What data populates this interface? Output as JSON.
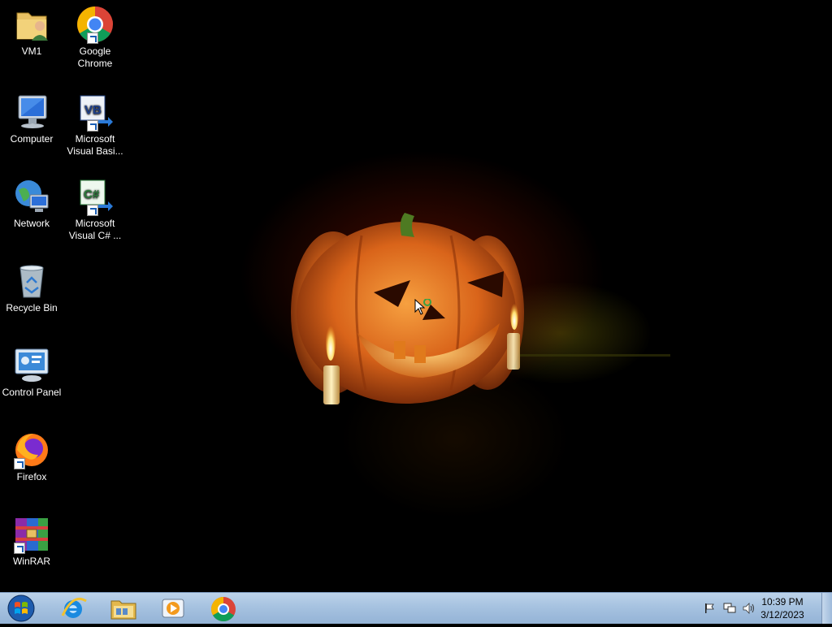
{
  "desktop": {
    "icons": [
      {
        "label": "VM1",
        "icon": "user-folder-icon"
      },
      {
        "label": "Google Chrome",
        "icon": "chrome-icon"
      },
      {
        "label": "Computer",
        "icon": "computer-icon"
      },
      {
        "label": "Microsoft Visual Basi...",
        "icon": "visual-basic-icon"
      },
      {
        "label": "Network",
        "icon": "network-icon"
      },
      {
        "label": "Microsoft Visual C# ...",
        "icon": "visual-csharp-icon"
      },
      {
        "label": "Recycle Bin",
        "icon": "recycle-bin-icon"
      },
      {
        "label": "Control Panel",
        "icon": "control-panel-icon"
      },
      {
        "label": "Firefox",
        "icon": "firefox-icon"
      },
      {
        "label": "WinRAR",
        "icon": "winrar-icon"
      }
    ],
    "wallpaper": "halloween-pumpkin-candles",
    "colors": {
      "glow_orange": "#ff8c1e",
      "glow_red": "#8c1400",
      "pumpkin": "#e0701a"
    }
  },
  "taskbar": {
    "pinned": [
      {
        "name": "start-button",
        "icon": "windows-orb-icon"
      },
      {
        "name": "internet-explorer",
        "icon": "internet-explorer-icon"
      },
      {
        "name": "windows-explorer",
        "icon": "folder-icon"
      },
      {
        "name": "media-player",
        "icon": "media-player-icon"
      },
      {
        "name": "google-chrome",
        "icon": "chrome-icon"
      }
    ],
    "tray_icons": [
      "action-center-flag-icon",
      "network-icon",
      "volume-icon"
    ],
    "clock": {
      "time": "10:39 PM",
      "date": "3/12/2023"
    },
    "colors": {
      "taskbar_top": "#bcd3ea",
      "taskbar_bottom": "#94b3d6"
    }
  }
}
